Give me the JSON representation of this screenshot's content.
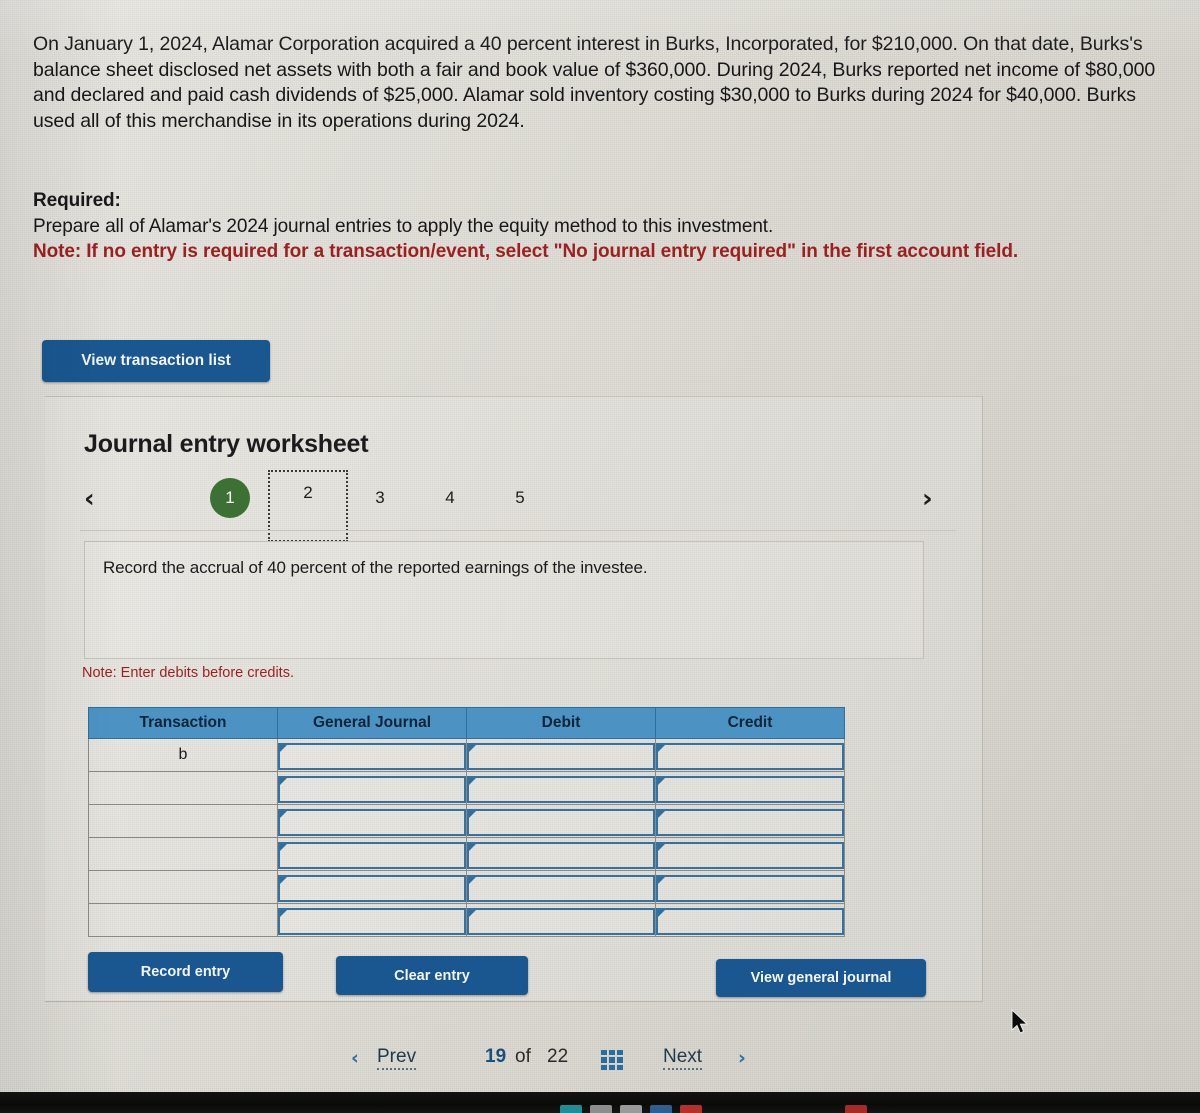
{
  "problem": {
    "text": "On January 1, 2024, Alamar Corporation acquired a 40 percent interest in Burks, Incorporated, for $210,000. On that date, Burks's balance sheet disclosed net assets with both a fair and book value of $360,000. During 2024, Burks reported net income of $80,000 and declared and paid cash dividends of $25,000. Alamar sold inventory costing $30,000 to Burks during 2024 for $40,000. Burks used all of this merchandise in its operations during 2024."
  },
  "required": {
    "heading": "Required:",
    "line1": "Prepare all of Alamar's 2024 journal entries to apply the equity method to this investment.",
    "note": "Note: If no entry is required for a transaction/event, select \"No journal entry required\" in the first account field."
  },
  "toolbar": {
    "view_transaction_list": "View transaction list"
  },
  "worksheet": {
    "title": "Journal entry worksheet",
    "prev_chevron": "‹",
    "next_chevron": "›",
    "tabs": [
      {
        "label": "1",
        "state": "active"
      },
      {
        "label": "2",
        "state": "focused"
      },
      {
        "label": "3",
        "state": "normal"
      },
      {
        "label": "4",
        "state": "normal"
      },
      {
        "label": "5",
        "state": "normal"
      }
    ],
    "instruction": "Record the accrual of 40 percent of the reported earnings of the investee.",
    "note_debits": "Note: Enter debits before credits.",
    "table": {
      "columns": [
        "Transaction",
        "General Journal",
        "Debit",
        "Credit"
      ],
      "rows": [
        {
          "transaction": "b",
          "general_journal": "",
          "debit": "",
          "credit": ""
        },
        {
          "transaction": "",
          "general_journal": "",
          "debit": "",
          "credit": ""
        },
        {
          "transaction": "",
          "general_journal": "",
          "debit": "",
          "credit": ""
        },
        {
          "transaction": "",
          "general_journal": "",
          "debit": "",
          "credit": ""
        },
        {
          "transaction": "",
          "general_journal": "",
          "debit": "",
          "credit": ""
        },
        {
          "transaction": "",
          "general_journal": "",
          "debit": "",
          "credit": ""
        }
      ]
    },
    "actions": {
      "record_entry": "Record entry",
      "clear_entry": "Clear entry",
      "view_general_journal": "View general journal"
    }
  },
  "pager": {
    "prev_chevron": "‹",
    "prev_label": "Prev",
    "current": "19",
    "of_label": "of",
    "total": "22",
    "grid_icon": "grid-icon",
    "next_label": "Next",
    "next_chevron": "›"
  },
  "colors": {
    "button_blue": "#1a5791",
    "table_header_blue": "#4c93c3",
    "cell_border_blue": "#36729f",
    "active_tab_green": "#3c7034",
    "note_red": "#9e1f1f",
    "page_bg": "#dedcd4"
  }
}
